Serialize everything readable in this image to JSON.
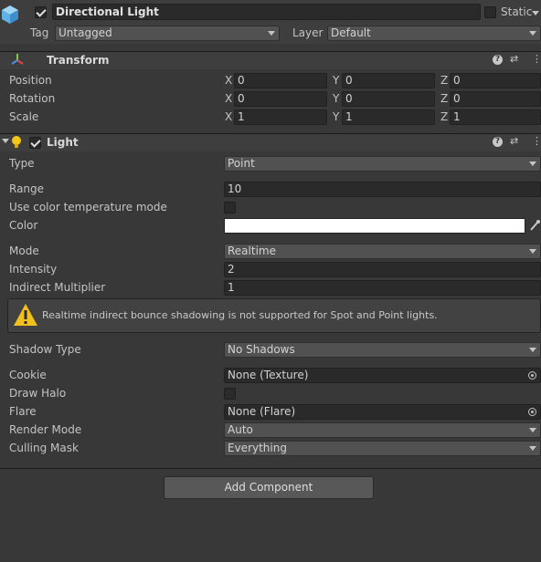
{
  "object": {
    "name": "Directional Light",
    "enabled": true,
    "static_label": "Static",
    "static": false,
    "tag_label": "Tag",
    "tag_value": "Untagged",
    "layer_label": "Layer",
    "layer_value": "Default"
  },
  "transform": {
    "title": "Transform",
    "rows": [
      {
        "label": "Position",
        "x": "0",
        "y": "0",
        "z": "0"
      },
      {
        "label": "Rotation",
        "x": "0",
        "y": "0",
        "z": "0"
      },
      {
        "label": "Scale",
        "x": "1",
        "y": "1",
        "z": "1"
      }
    ],
    "axis": {
      "x": "X",
      "y": "Y",
      "z": "Z"
    }
  },
  "light": {
    "title": "Light",
    "enabled": true,
    "type_label": "Type",
    "type_value": "Point",
    "range_label": "Range",
    "range_value": "10",
    "color_temp_label": "Use color temperature mode",
    "color_label": "Color",
    "color_value": "#ffffff",
    "mode_label": "Mode",
    "mode_value": "Realtime",
    "intensity_label": "Intensity",
    "intensity_value": "2",
    "indirect_label": "Indirect Multiplier",
    "indirect_value": "1",
    "warning_text": "Realtime indirect bounce shadowing is not supported for Spot and Point lights.",
    "shadow_type_label": "Shadow Type",
    "shadow_type_value": "No Shadows",
    "cookie_label": "Cookie",
    "cookie_value": "None (Texture)",
    "draw_halo_label": "Draw Halo",
    "flare_label": "Flare",
    "flare_value": "None (Flare)",
    "render_mode_label": "Render Mode",
    "render_mode_value": "Auto",
    "culling_mask_label": "Culling Mask",
    "culling_mask_value": "Everything"
  },
  "add_component_label": "Add Component",
  "colors": {
    "background": "#383838",
    "field": "#2a2a2a",
    "warning_icon": "#f0c020"
  },
  "icons": {
    "game_object": "cube-icon",
    "transform": "transform-axes-icon",
    "light": "light-bulb-icon",
    "help": "help-icon",
    "presets": "presets-icon",
    "menu": "kebab-menu-icon",
    "warning": "warning-icon",
    "color_picker": "eyedropper-icon"
  }
}
